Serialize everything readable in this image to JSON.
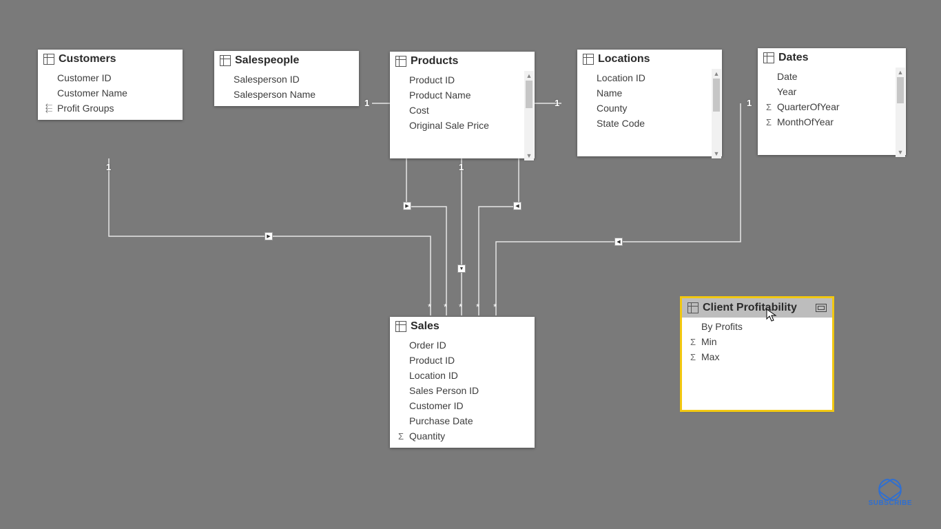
{
  "tables": {
    "customers": {
      "title": "Customers",
      "fields": [
        {
          "label": "Customer ID",
          "icon": ""
        },
        {
          "label": "Customer Name",
          "icon": ""
        },
        {
          "label": "Profit Groups",
          "icon": "hier"
        }
      ]
    },
    "salespeople": {
      "title": "Salespeople",
      "fields": [
        {
          "label": "Salesperson ID",
          "icon": ""
        },
        {
          "label": "Salesperson Name",
          "icon": ""
        }
      ]
    },
    "products": {
      "title": "Products",
      "fields": [
        {
          "label": "Product ID",
          "icon": ""
        },
        {
          "label": "Product Name",
          "icon": ""
        },
        {
          "label": "Cost",
          "icon": ""
        },
        {
          "label": "Original Sale Price",
          "icon": ""
        }
      ]
    },
    "locations": {
      "title": "Locations",
      "fields": [
        {
          "label": "Location ID",
          "icon": ""
        },
        {
          "label": "Name",
          "icon": ""
        },
        {
          "label": "County",
          "icon": ""
        },
        {
          "label": "State Code",
          "icon": ""
        }
      ]
    },
    "dates": {
      "title": "Dates",
      "fields": [
        {
          "label": "Date",
          "icon": ""
        },
        {
          "label": "Year",
          "icon": ""
        },
        {
          "label": "QuarterOfYear",
          "icon": "sigma"
        },
        {
          "label": "MonthOfYear",
          "icon": "sigma"
        }
      ]
    },
    "sales": {
      "title": "Sales",
      "fields": [
        {
          "label": "Order ID",
          "icon": ""
        },
        {
          "label": "Product ID",
          "icon": ""
        },
        {
          "label": "Location ID",
          "icon": ""
        },
        {
          "label": "Sales Person ID",
          "icon": ""
        },
        {
          "label": "Customer ID",
          "icon": ""
        },
        {
          "label": "Purchase Date",
          "icon": ""
        },
        {
          "label": "Quantity",
          "icon": "sigma"
        }
      ]
    },
    "client_profitability": {
      "title": "Client Profitability",
      "fields": [
        {
          "label": "By Profits",
          "icon": ""
        },
        {
          "label": "Min",
          "icon": "sigma"
        },
        {
          "label": "Max",
          "icon": "sigma"
        }
      ]
    }
  },
  "cardinality": {
    "one": "1",
    "many": "*"
  },
  "watermark": "SUBSCRIBE"
}
